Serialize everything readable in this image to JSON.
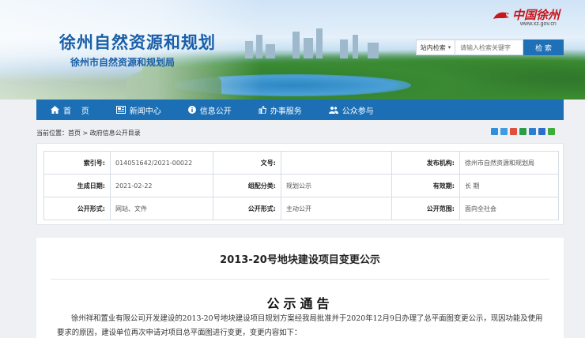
{
  "header": {
    "site_title": "徐州自然资源和规划",
    "site_subtitle": "徐州市自然资源和规划局",
    "brand_name": "中国徐州",
    "brand_url": "www.xz.gov.cn"
  },
  "search": {
    "scope_label": "站内检索",
    "placeholder": "请输入检索关键字",
    "button_label": "检 索"
  },
  "nav": {
    "items": [
      {
        "label": "首    页",
        "icon": "home-icon"
      },
      {
        "label": "新闻中心",
        "icon": "newspaper-icon"
      },
      {
        "label": "信息公开",
        "icon": "info-icon"
      },
      {
        "label": "办事服务",
        "icon": "thumbs-up-icon"
      },
      {
        "label": "公众参与",
        "icon": "users-icon"
      }
    ]
  },
  "breadcrumb": {
    "prefix": "当前位置：",
    "home": "首页",
    "sep": " > ",
    "current": "政府信息公开目录"
  },
  "info": {
    "rows": [
      [
        {
          "label": "索引号:",
          "value": "014051642/2021-00022"
        },
        {
          "label": "文号:",
          "value": ""
        },
        {
          "label": "发布机构:",
          "value": "徐州市自然资源和规划局"
        }
      ],
      [
        {
          "label": "生成日期:",
          "value": "2021-02-22"
        },
        {
          "label": "组配分类:",
          "value": "规划公示"
        },
        {
          "label": "有效期:",
          "value": "长 期"
        }
      ],
      [
        {
          "label": "公开形式:",
          "value": "网站、文件"
        },
        {
          "label": "公开形式:",
          "value": "主动公开"
        },
        {
          "label": "公开范围:",
          "value": "面向全社会"
        }
      ]
    ]
  },
  "article": {
    "title": "2013-20号地块建设项目变更公示",
    "heading": "公示通告",
    "paragraph": "徐州祥和置业有限公司开发建设的2013-20号地块建设项目规划方案经我局批准并于2020年12月9日办理了总平面图变更公示，现因功能及使用要求的原因，建设单位再次申请对项目总平面图进行变更，变更内容如下："
  },
  "colors": {
    "primary_blue": "#1c6fb5",
    "brand_red": "#c8161d"
  }
}
